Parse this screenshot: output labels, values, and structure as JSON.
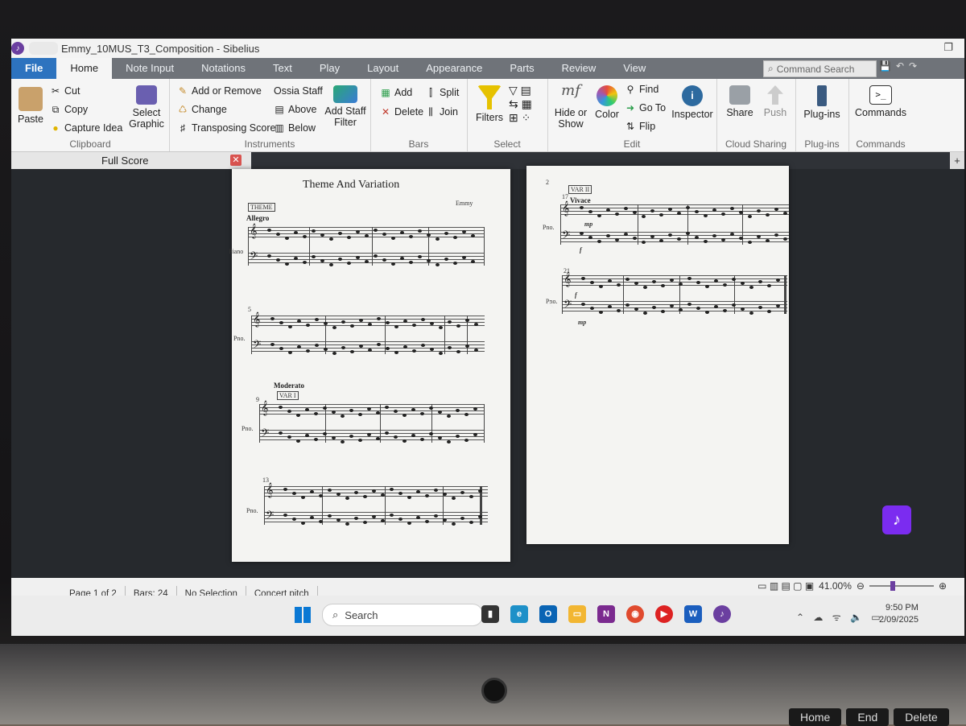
{
  "window": {
    "title": "Emmy_10MUS_T3_Composition - Sibelius"
  },
  "menu_tabs": [
    "File",
    "Home",
    "Note Input",
    "Notations",
    "Text",
    "Play",
    "Layout",
    "Appearance",
    "Parts",
    "Review",
    "View"
  ],
  "command_search": {
    "placeholder": "Command Search"
  },
  "ribbon": {
    "clipboard": {
      "label": "Clipboard",
      "paste": "Paste",
      "cut": "Cut",
      "copy": "Copy",
      "capture_idea": "Capture Idea",
      "select_graphic": "Select Graphic"
    },
    "instruments": {
      "label": "Instruments",
      "add_remove": "Add or Remove",
      "change": "Change",
      "transposing": "Transposing Score",
      "ossia": "Ossia Staff",
      "above": "Above",
      "below": "Below",
      "add_staff_filter": "Add Staff Filter"
    },
    "bars": {
      "label": "Bars",
      "add": "Add",
      "delete": "Delete",
      "split": "Split",
      "join": "Join"
    },
    "select": {
      "label": "Select",
      "filters": "Filters"
    },
    "edit": {
      "label": "Edit",
      "hide_show": "Hide or Show",
      "color": "Color",
      "find": "Find",
      "go_to": "Go To",
      "flip": "Flip",
      "inspector": "Inspector"
    },
    "cloud": {
      "label": "Cloud Sharing",
      "share": "Share",
      "push": "Push"
    },
    "plugins": {
      "label": "Plug-ins",
      "plugins": "Plug-ins"
    },
    "commands": {
      "label": "Commands",
      "commands": "Commands"
    }
  },
  "panel": {
    "title": "Full Score"
  },
  "score": {
    "title": "Theme And Variation",
    "composer": "Emmy",
    "page1": {
      "theme_label": "THEME",
      "tempo1": "Allegro",
      "instrument": "Piano",
      "short_instr": "Pno.",
      "bar5": "5",
      "tempo2": "Moderato",
      "var1_label": "VAR I",
      "bar9": "9",
      "bar13": "13"
    },
    "page2": {
      "page_num": "2",
      "var2_label": "VAR II",
      "bar17": "17",
      "tempo": "Vivace",
      "dyn_mp": "mp",
      "dyn_f": "f",
      "bar21": "21",
      "short_instr": "Pno."
    }
  },
  "status": {
    "page": "Page 1 of 2",
    "bars": "Bars: 24",
    "selection": "No Selection",
    "pitch": "Concert pitch",
    "zoom": "41.00%"
  },
  "taskbar": {
    "search_placeholder": "Search",
    "time": "9:50 PM",
    "date": "2/09/2025"
  },
  "keyboard": [
    "Home",
    "End",
    "Delete"
  ]
}
